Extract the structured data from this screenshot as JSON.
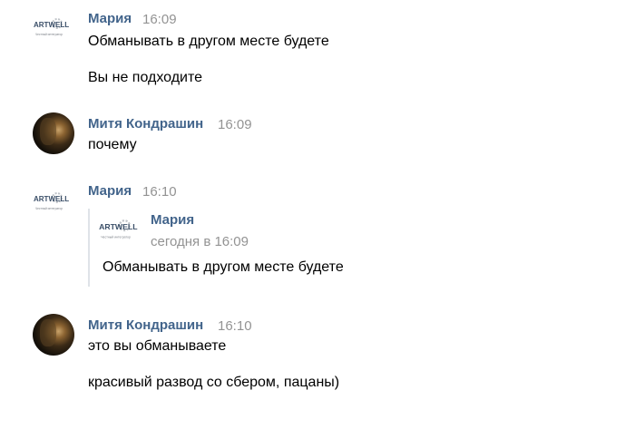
{
  "messages": [
    {
      "author": "Мария",
      "time": "16:09",
      "avatar_text": "ARTWELL",
      "avatar_sub": "Честный интегратор",
      "lines": [
        "Обманывать в другом месте будете",
        "Вы не подходите"
      ]
    },
    {
      "author": "Митя Кондрашин",
      "time": "16:09",
      "lines": [
        "почему"
      ]
    },
    {
      "author": "Мария",
      "time": "16:10",
      "avatar_text": "ARTWELL",
      "avatar_sub": "Честный интегратор",
      "quote": {
        "author": "Мария",
        "date": "сегодня в 16:09",
        "text": "Обманывать в другом месте будете"
      }
    },
    {
      "author": "Митя Кондрашин",
      "time": "16:10",
      "lines": [
        "это вы обманываете",
        "красивый развод со сбером, пацаны)"
      ]
    }
  ]
}
